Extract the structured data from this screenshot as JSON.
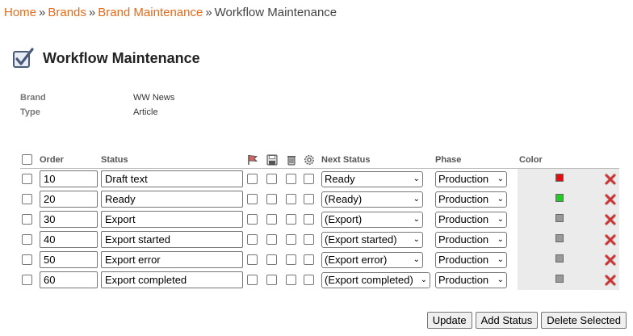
{
  "breadcrumb": {
    "home": "Home",
    "brands": "Brands",
    "brand_maintenance": "Brand Maintenance",
    "current": "Workflow Maintenance",
    "separator": "»"
  },
  "page": {
    "title": "Workflow Maintenance"
  },
  "meta": {
    "brand_label": "Brand",
    "brand_value": "WW News",
    "type_label": "Type",
    "type_value": "Article"
  },
  "table": {
    "headers": {
      "order": "Order",
      "status": "Status",
      "next_status": "Next Status",
      "phase": "Phase",
      "color": "Color"
    },
    "header_icons": [
      "flag-icon",
      "save-icon",
      "trash-icon",
      "gear-icon"
    ],
    "rows": [
      {
        "order": "10",
        "status": "Draft text",
        "next_status": "Ready",
        "phase": "Production",
        "color": "#e01010"
      },
      {
        "order": "20",
        "status": "Ready",
        "next_status": "(Ready)",
        "phase": "Production",
        "color": "#22cc22"
      },
      {
        "order": "30",
        "status": "Export",
        "next_status": "(Export)",
        "phase": "Production",
        "color": "#999999"
      },
      {
        "order": "40",
        "status": "Export started",
        "next_status": "(Export started)",
        "phase": "Production",
        "color": "#999999"
      },
      {
        "order": "50",
        "status": "Export error",
        "next_status": "(Export error)",
        "phase": "Production",
        "color": "#999999"
      },
      {
        "order": "60",
        "status": "Export completed",
        "next_status": "(Export completed)",
        "phase": "Production",
        "color": "#999999"
      }
    ]
  },
  "buttons": {
    "update": "Update",
    "add_status": "Add Status",
    "delete_selected": "Delete Selected"
  },
  "colors": {
    "link": "#e56a19",
    "delete": "#cc3333"
  }
}
